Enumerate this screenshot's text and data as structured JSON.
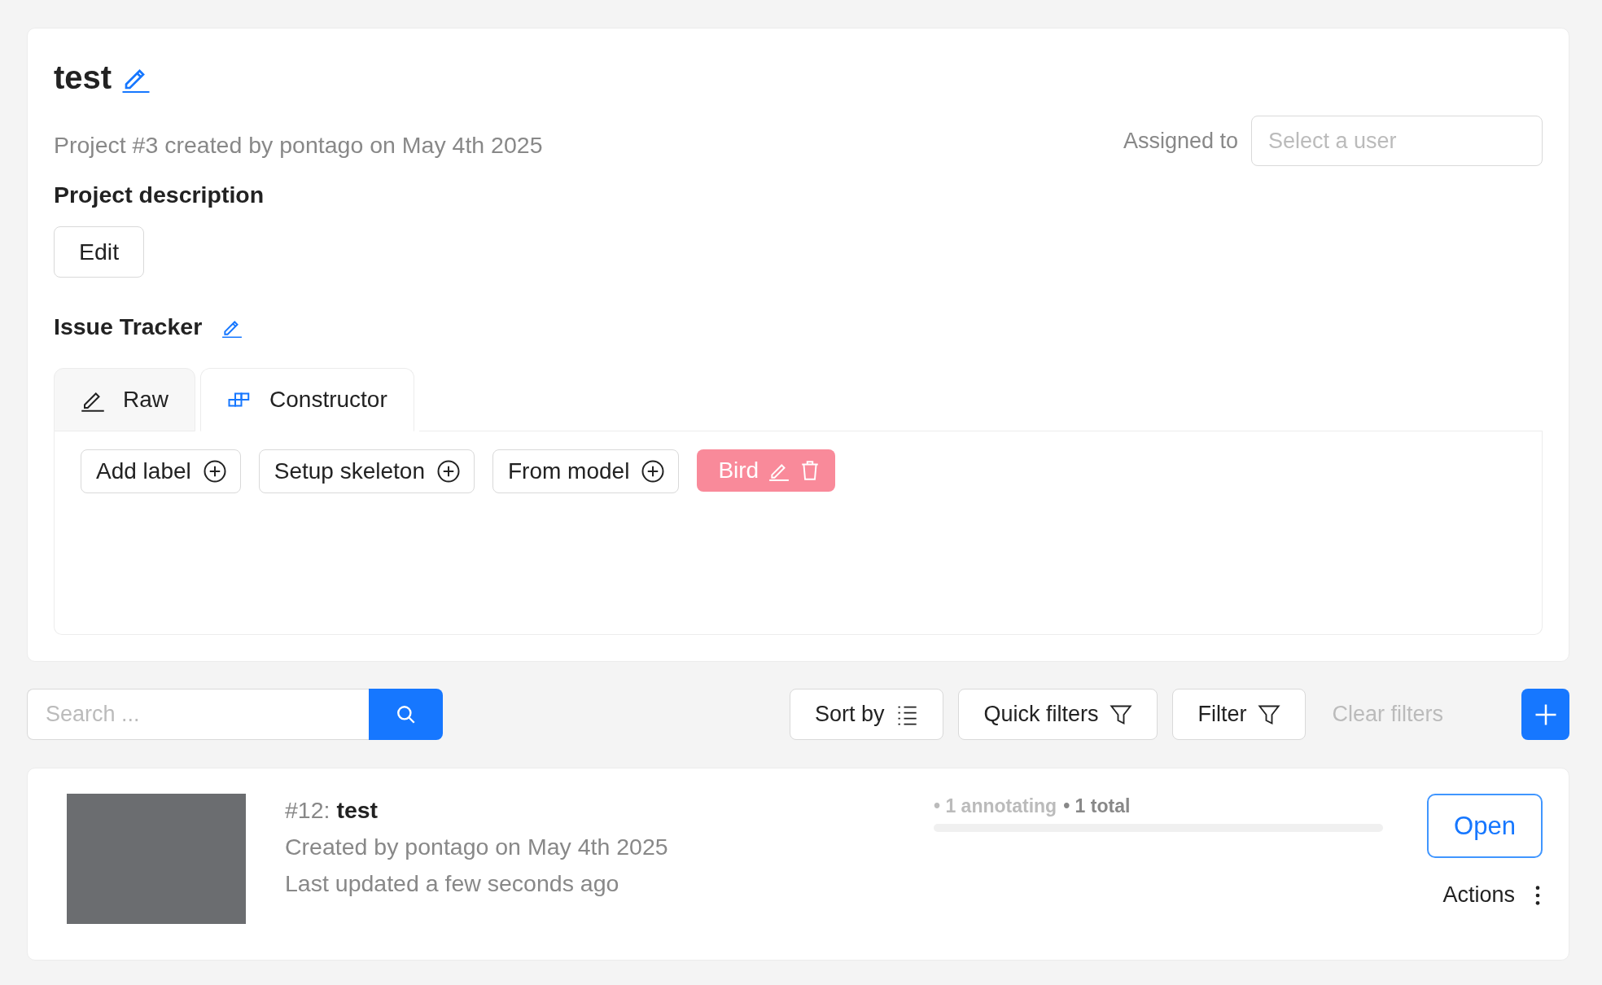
{
  "project": {
    "title": "test",
    "subtitle": "Project #3 created by pontago on May 4th 2025",
    "assignee": {
      "label": "Assigned to",
      "placeholder": "Select a user"
    },
    "description_heading": "Project description",
    "edit_button": "Edit",
    "issue_tracker": "Issue Tracker"
  },
  "tabs": [
    {
      "label": "Raw",
      "kind": "raw",
      "selected": false
    },
    {
      "label": "Constructor",
      "kind": "constructor",
      "selected": true
    }
  ],
  "label_actions": [
    "Add label",
    "Setup skeleton",
    "From model"
  ],
  "labels": [
    {
      "name": "Bird",
      "color": "#f98a9a"
    }
  ],
  "toolbar": {
    "search_placeholder": "Search ...",
    "sort": "Sort by",
    "quick_filters": "Quick filters",
    "filter": "Filter",
    "clear_filters": "Clear filters"
  },
  "tasks": [
    {
      "name": "#12: **test**",
      "created": "Created by pontago on May 4th 2025",
      "updated": "Last updated a few seconds ago",
      "annotating": "• 1 annotating",
      "total": "• 1 total",
      "level": 0,
      "open": "Open",
      "actions": "Actions"
    }
  ]
}
